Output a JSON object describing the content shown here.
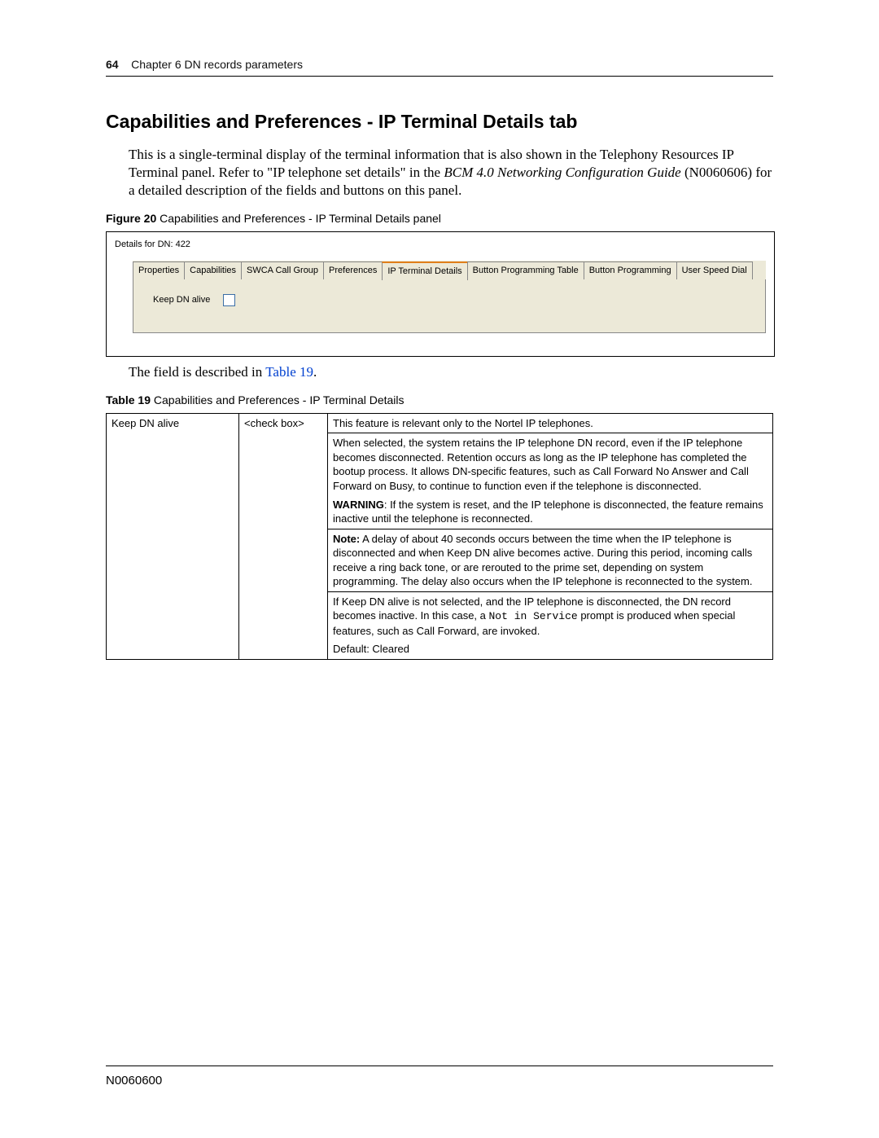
{
  "header": {
    "page_number": "64",
    "chapter": "Chapter 6  DN records parameters"
  },
  "section_title": "Capabilities and Preferences - IP Terminal Details tab",
  "intro_1": "This is a single-terminal display of the terminal information that is also shown in the Telephony Resources IP Terminal panel. Refer to \"IP telephone set details\" in the ",
  "intro_em": "BCM 4.0 Networking Configuration Guide",
  "intro_2": " (N0060606) for a detailed description of the fields and buttons on this panel.",
  "figure": {
    "label_bold": "Figure 20",
    "label_rest": "   Capabilities and Preferences - IP Terminal Details panel"
  },
  "panel": {
    "title": "Details for DN: 422",
    "tabs": [
      "Properties",
      "Capabilities",
      "SWCA Call Group",
      "Preferences",
      "IP Terminal Details",
      "Button Programming Table",
      "Button Programming",
      "User Speed Dial"
    ],
    "active_tab_index": 4,
    "field_label": "Keep DN alive"
  },
  "post_figure_text_1": "The field is described in ",
  "post_figure_link": "Table 19",
  "post_figure_text_2": ".",
  "table_caption": {
    "label_bold": "Table 19",
    "label_rest": "   Capabilities and Preferences - IP Terminal Details"
  },
  "table": {
    "col1": "Keep DN alive",
    "col2": "<check box>",
    "para1": "This feature is relevant only to the Nortel IP telephones.",
    "para2": "When selected, the system retains the IP telephone DN record, even if the IP telephone becomes disconnected. Retention occurs as long as the IP telephone has completed the bootup process. It allows DN-specific features, such as Call Forward No Answer and Call Forward on Busy, to continue to function even if the telephone is disconnected.",
    "warn_label": "WARNING",
    "warn_text": ": If the system is reset, and the IP telephone is disconnected, the feature remains inactive until the telephone is reconnected.",
    "note_label": "Note:",
    "note_text": " A delay of about 40 seconds occurs between the time when the IP telephone is disconnected and when Keep DN alive becomes active. During this period, incoming calls receive a ring back tone, or are rerouted to the prime set, depending on system programming. The delay also occurs when the IP telephone is reconnected to the system.",
    "para5a": "If Keep DN alive is not selected, and the IP telephone is disconnected, the DN record becomes inactive. In this case, a ",
    "para5_mono": "Not in Service",
    "para5b": " prompt is produced when special features, such as Call Forward, are invoked.",
    "para6": "Default: Cleared"
  },
  "footer": "N0060600"
}
